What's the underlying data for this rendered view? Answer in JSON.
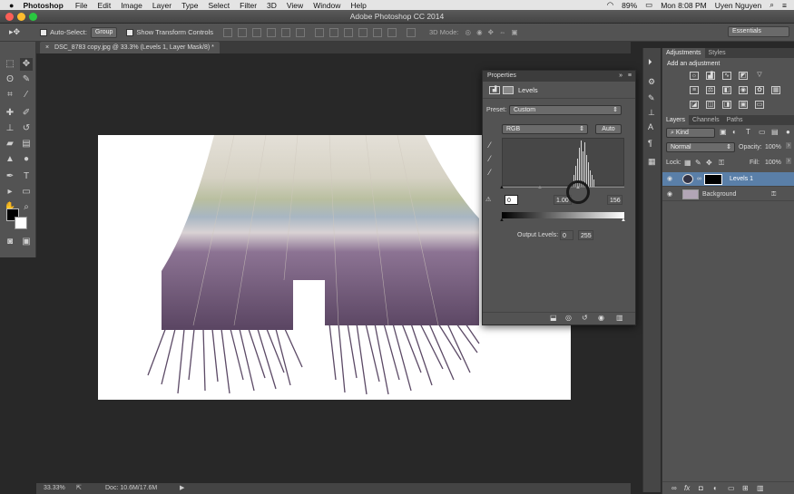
{
  "menubar": {
    "apple": "",
    "app": "Photoshop",
    "items": [
      "File",
      "Edit",
      "Image",
      "Layer",
      "Type",
      "Select",
      "Filter",
      "3D",
      "View",
      "Window",
      "Help"
    ],
    "status": {
      "battery": "89%",
      "datetime": "Mon 8:08 PM",
      "user": "Uyen Nguyen"
    }
  },
  "titlebar": {
    "title": "Adobe Photoshop CC 2014"
  },
  "options": {
    "auto_select_label": "Auto-Select:",
    "auto_select_value": "Group",
    "transform_label": "Show Transform Controls",
    "mode_3d": "3D Mode:",
    "workspace": "Essentials"
  },
  "doc_tab": {
    "label": "DSC_8783 copy.jpg @ 33.3% (Levels 1, Layer Mask/8) *"
  },
  "status": {
    "zoom": "33.33%",
    "doc": "Doc: 10.6M/17.6M"
  },
  "properties": {
    "tab": "Properties",
    "title": "Levels",
    "preset_label": "Preset:",
    "preset_value": "Custom",
    "channel": "RGB",
    "auto": "Auto",
    "input_black": "0",
    "input_gamma": "1.00",
    "input_white": "156",
    "output_label": "Output Levels:",
    "output_black": "0",
    "output_white": "255"
  },
  "adjustments": {
    "tabs": [
      "Adjustments",
      "Styles"
    ],
    "heading": "Add an adjustment"
  },
  "layers": {
    "tabs": [
      "Layers",
      "Channels",
      "Paths"
    ],
    "kind": "Kind",
    "blend": "Normal",
    "opacity_label": "Opacity:",
    "opacity": "100%",
    "lock_label": "Lock:",
    "fill_label": "Fill:",
    "fill": "100%",
    "rows": [
      {
        "name": "Levels 1",
        "selected": true
      },
      {
        "name": "Background",
        "selected": false
      }
    ]
  },
  "colors": {
    "accent": "#5a7fa8",
    "panel": "#535353",
    "canvas": "#282828"
  }
}
